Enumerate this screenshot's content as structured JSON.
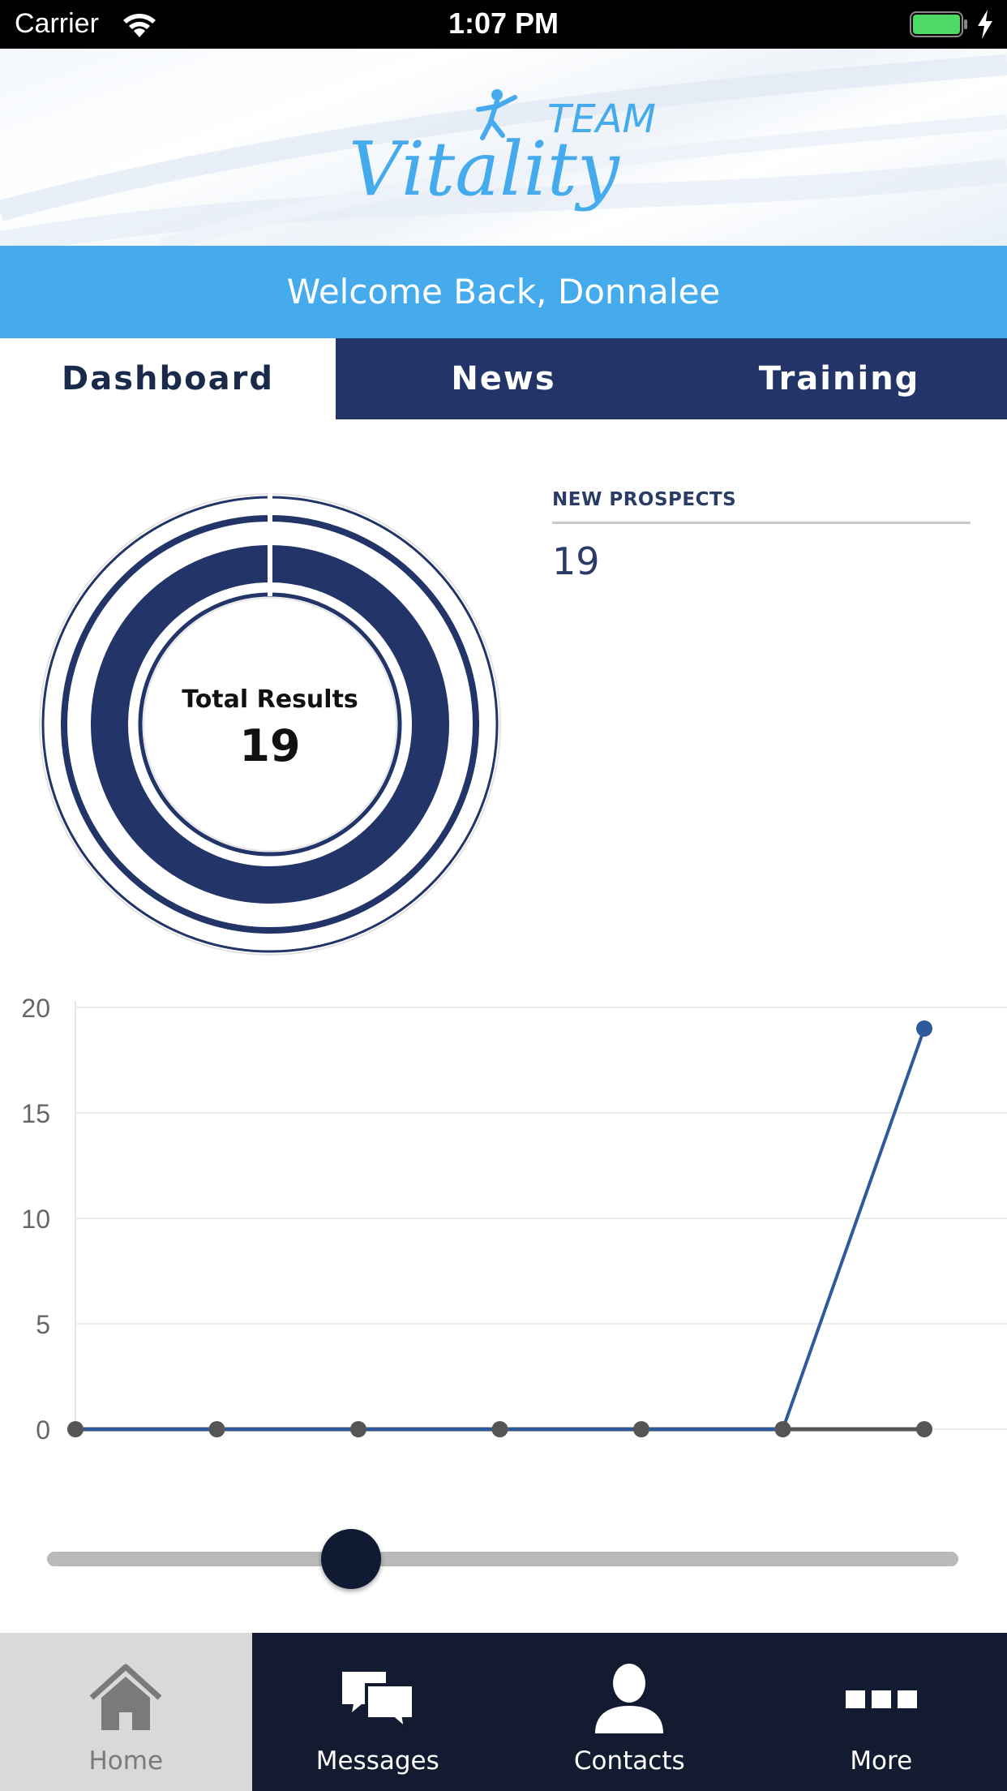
{
  "status_bar": {
    "carrier": "Carrier",
    "time": "1:07 PM",
    "battery_color": "#4cd964"
  },
  "header": {
    "logo_text_team": "TEAM",
    "logo_text_brand": "Vitality",
    "logo_color": "#45abec"
  },
  "welcome": {
    "text": "Welcome Back, Donnalee"
  },
  "tabs": [
    {
      "label": "Dashboard",
      "active": true
    },
    {
      "label": "News",
      "active": false
    },
    {
      "label": "Training",
      "active": false
    }
  ],
  "donut": {
    "label": "Total Results",
    "value": "19",
    "color": "#223468"
  },
  "prospects": {
    "title": "NEW PROSPECTS",
    "value": "19"
  },
  "chart_data": {
    "type": "line",
    "ylim": [
      0,
      20
    ],
    "yticks": [
      "0",
      "5",
      "10",
      "15",
      "20"
    ],
    "grid": true,
    "series": [
      {
        "color": "#2e5a9c",
        "values": [
          0,
          0,
          0,
          0,
          0,
          0,
          19
        ]
      },
      {
        "color": "#555555",
        "values": [
          0,
          0,
          0,
          0,
          0,
          0,
          0
        ]
      }
    ]
  },
  "slider": {
    "value_fraction": 0.3
  },
  "bottom_nav": [
    {
      "label": "Home",
      "icon": "home-icon",
      "active": true
    },
    {
      "label": "Messages",
      "icon": "messages-icon",
      "active": false
    },
    {
      "label": "Contacts",
      "icon": "contacts-icon",
      "active": false
    },
    {
      "label": "More",
      "icon": "more-icon",
      "active": false
    }
  ]
}
